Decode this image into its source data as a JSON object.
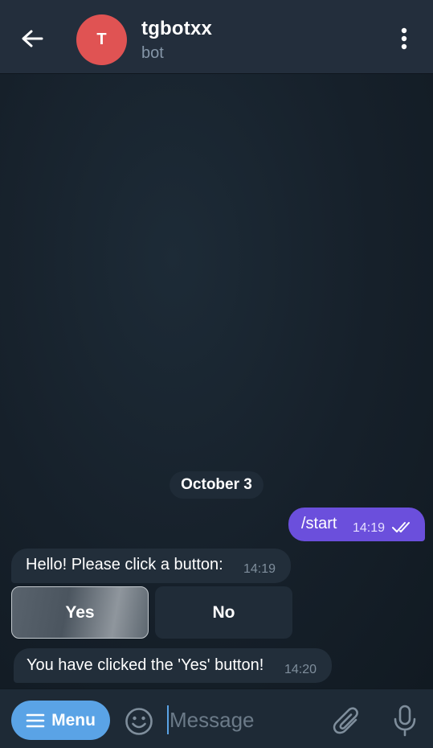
{
  "header": {
    "back_icon": "arrow-left-icon",
    "avatar_letter": "T",
    "avatar_color": "#e05353",
    "title": "tgbotxx",
    "subtitle": "bot",
    "more_icon": "more-vertical-icon"
  },
  "chat": {
    "date_separator": "October 3",
    "messages": [
      {
        "direction": "outgoing",
        "text": "/start",
        "time": "14:19",
        "status": "read",
        "color": "#6b4fdc"
      },
      {
        "direction": "incoming",
        "text": "Hello! Please click a button:",
        "time": "14:19"
      },
      {
        "direction": "incoming",
        "text": "You have clicked the 'Yes' button!",
        "time": "14:20"
      }
    ],
    "inline_keyboard": [
      {
        "label": "Yes",
        "selected": true
      },
      {
        "label": "No",
        "selected": false
      }
    ]
  },
  "input_bar": {
    "menu_label": "Menu",
    "menu_icon": "hamburger-icon",
    "menu_color": "#5aa3e6",
    "emoji_icon": "emoji-smile-icon",
    "placeholder": "Message",
    "value": "",
    "attach_icon": "paperclip-icon",
    "mic_icon": "microphone-icon"
  }
}
